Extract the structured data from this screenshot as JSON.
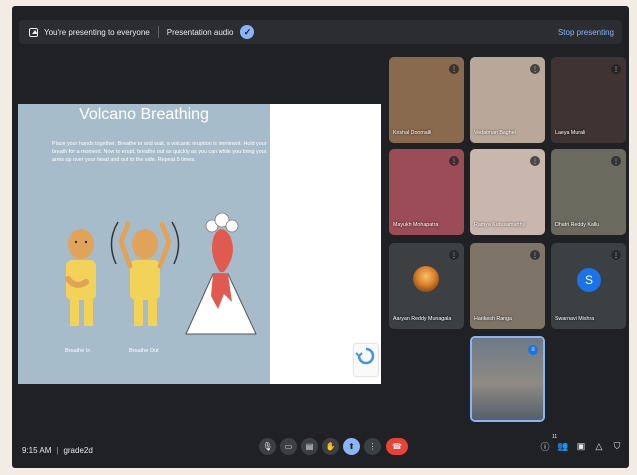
{
  "banner": {
    "presenting_text": "You're presenting to everyone",
    "audio_label": "Presentation audio",
    "stop_label": "Stop presenting"
  },
  "slide": {
    "title": "Volcano Breathing",
    "body": "Place your hands together. Breathe in and wait, a volcanic eruption is imminent. Hold your breath for a moment. Now to erupt, breathe out as quickly as you can while you bring your arms up over your head and out to the side. Repeat 5 times.",
    "caption_in": "Breathe In",
    "caption_out": "Breathe Out"
  },
  "participants": [
    {
      "name": "Krishal Doomalli",
      "bg": "#8a6a4e"
    },
    {
      "name": "Vedatman Baghel",
      "bg": "#b9a89a"
    },
    {
      "name": "Laeya Murali",
      "bg": "#3f3431"
    },
    {
      "name": "Mayukh Mohapatra",
      "bg": "#9b4c56"
    },
    {
      "name": "Ramya Kurusamurthy",
      "bg": "#c9b7ae"
    },
    {
      "name": "Dhatri Reddy Kallu",
      "bg": "#6a6a5f"
    },
    {
      "name": "Aaryan Reddy Munagala",
      "bg": "#3c4043"
    },
    {
      "name": "Harikesh Ranga",
      "bg": "#7f7468"
    },
    {
      "name": "Swarnavi Mishra",
      "bg": "#3c4043",
      "initial": "S"
    }
  ],
  "self_view": {
    "bg": "#5e6e7c"
  },
  "meeting": {
    "time": "9:15 AM",
    "separator": "|",
    "code": "grade2d",
    "participant_count": "11"
  },
  "colors": {
    "accent": "#8ab4f8",
    "end_call": "#ea4335",
    "slide_bg": "#a7bccb"
  }
}
